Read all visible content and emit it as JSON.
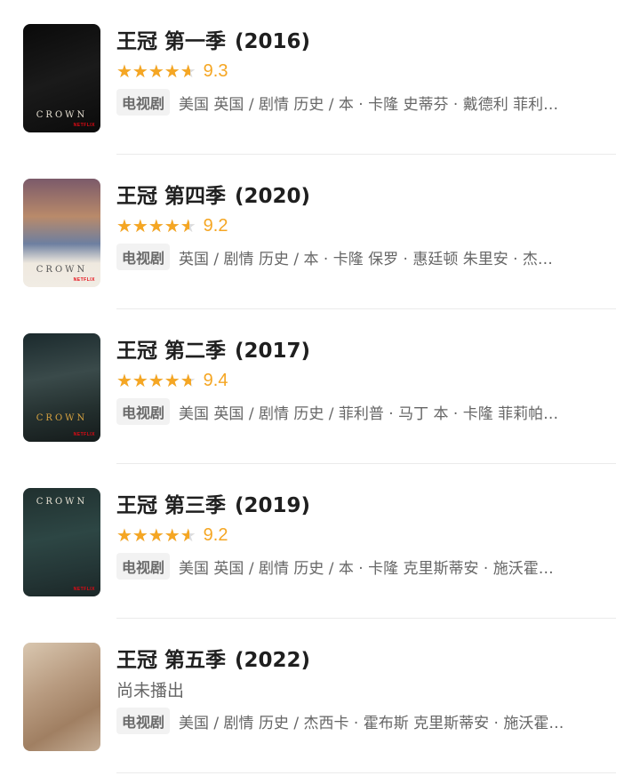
{
  "items": [
    {
      "title": "王冠 第一季",
      "year": "(2016)",
      "rating_fraction": 0.93,
      "score": "9.3",
      "status": "",
      "tag": "电视剧",
      "desc": "美国 英国 / 剧情 历史 / 本 · 卡隆 史蒂芬 · 戴德利 菲利…",
      "poster": {
        "bg": "linear-gradient(160deg,#0a0a0a 0%,#1a1a1a 50%,#0b0b0b 100%)",
        "word": "CROWN",
        "logo": "NETFLIX"
      }
    },
    {
      "title": "王冠 第四季",
      "year": "(2020)",
      "rating_fraction": 0.92,
      "score": "9.2",
      "status": "",
      "tag": "电视剧",
      "desc": "英国 / 剧情 历史 / 本 · 卡隆 保罗 · 惠廷顿 朱里安 · 杰…",
      "poster": {
        "bg": "linear-gradient(180deg,#7b5a6a 0%,#b98a6a 35%,#6d7fa0 60%,#efe9df 78%,#f1ece4 100%)",
        "word": "CROWN",
        "logo": "NETFLIX"
      }
    },
    {
      "title": "王冠 第二季",
      "year": "(2017)",
      "rating_fraction": 0.94,
      "score": "9.4",
      "status": "",
      "tag": "电视剧",
      "desc": "美国 英国 / 剧情 历史 / 菲利普 · 马丁 本 · 卡隆 菲莉帕…",
      "poster": {
        "bg": "linear-gradient(170deg,#1b2a2d 0%,#3a4a4a 40%,#24302f 70%,#151b1b 100%)",
        "word": "CROWN",
        "logo": "NETFLIX"
      }
    },
    {
      "title": "王冠 第三季",
      "year": "(2019)",
      "rating_fraction": 0.92,
      "score": "9.2",
      "status": "",
      "tag": "电视剧",
      "desc": "美国 英国 / 剧情 历史 / 本 · 卡隆 克里斯蒂安 · 施沃霍…",
      "poster": {
        "bg": "linear-gradient(170deg,#20302f 0%,#2d4644 45%,#243636 75%,#1b2727 100%)",
        "word": "CROWN",
        "logo": "NETFLIX"
      }
    },
    {
      "title": "王冠 第五季",
      "year": "(2022)",
      "rating_fraction": null,
      "score": "",
      "status": "尚未播出",
      "tag": "电视剧",
      "desc": "美国 / 剧情 历史 / 杰西卡 · 霍布斯 克里斯蒂安 · 施沃霍…",
      "poster": {
        "bg": "linear-gradient(150deg,#d9c7b0 0%,#b89b80 40%,#a07f62 70%,#c4ad95 100%)",
        "word": "",
        "logo": ""
      }
    }
  ],
  "colors": {
    "star": "#f5a623",
    "star_empty": "#dcdcdc"
  }
}
